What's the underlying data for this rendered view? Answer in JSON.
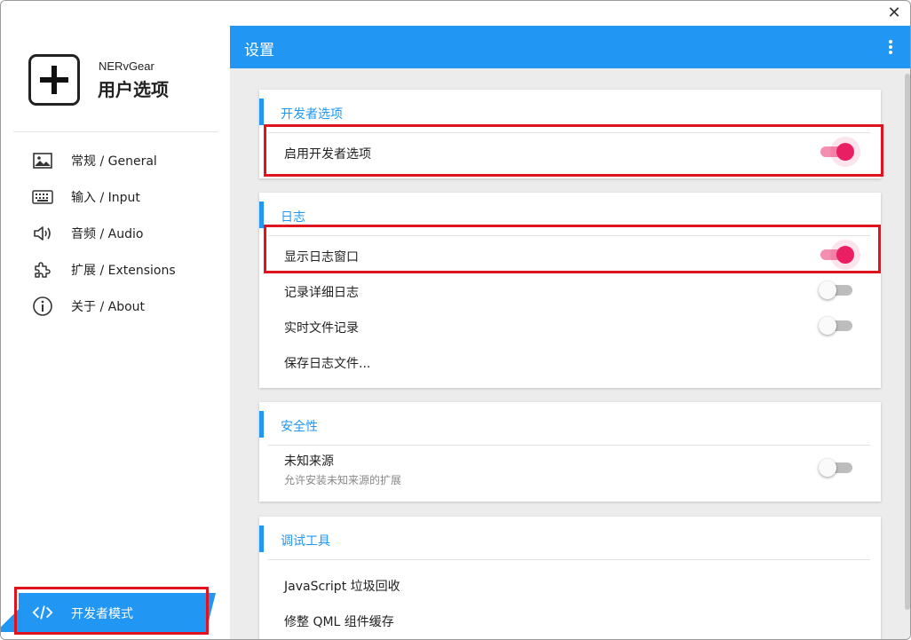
{
  "window": {
    "close_icon": "close-icon",
    "close_glyph": "✕"
  },
  "sidebar": {
    "brand_name": "NERvGear",
    "brand_title": "用户选项",
    "items": [
      {
        "label": "常规 / General",
        "icon": "image-icon"
      },
      {
        "label": "输入 / Input",
        "icon": "keyboard-icon"
      },
      {
        "label": "音频 / Audio",
        "icon": "speaker-icon"
      },
      {
        "label": "扩展 / Extensions",
        "icon": "puzzle-icon"
      },
      {
        "label": "关于 / About",
        "icon": "info-icon"
      }
    ],
    "active_item": {
      "label": "开发者模式",
      "icon": "code-icon"
    }
  },
  "appbar": {
    "title": "设置",
    "more_icon": "more-vertical-icon"
  },
  "sections": {
    "developer": {
      "title": "开发者选项",
      "rows": [
        {
          "label": "启用开发者选项",
          "toggle": true
        }
      ]
    },
    "log": {
      "title": "日志",
      "rows": [
        {
          "label": "显示日志窗口",
          "toggle": true
        },
        {
          "label": "记录详细日志",
          "toggle": false
        },
        {
          "label": "实时文件记录",
          "toggle": false
        },
        {
          "label": "保存日志文件..."
        }
      ]
    },
    "security": {
      "title": "安全性",
      "rows": [
        {
          "label": "未知来源",
          "sublabel": "允许安装未知来源的扩展",
          "toggle": false
        }
      ]
    },
    "debug": {
      "title": "调试工具",
      "rows": [
        {
          "label": "JavaScript 垃圾回收"
        },
        {
          "label": "修整 QML 组件缓存"
        }
      ]
    }
  },
  "colors": {
    "accent": "#2196f3",
    "toggle_on": "#e91e63",
    "highlight_box": "#e0141e"
  }
}
